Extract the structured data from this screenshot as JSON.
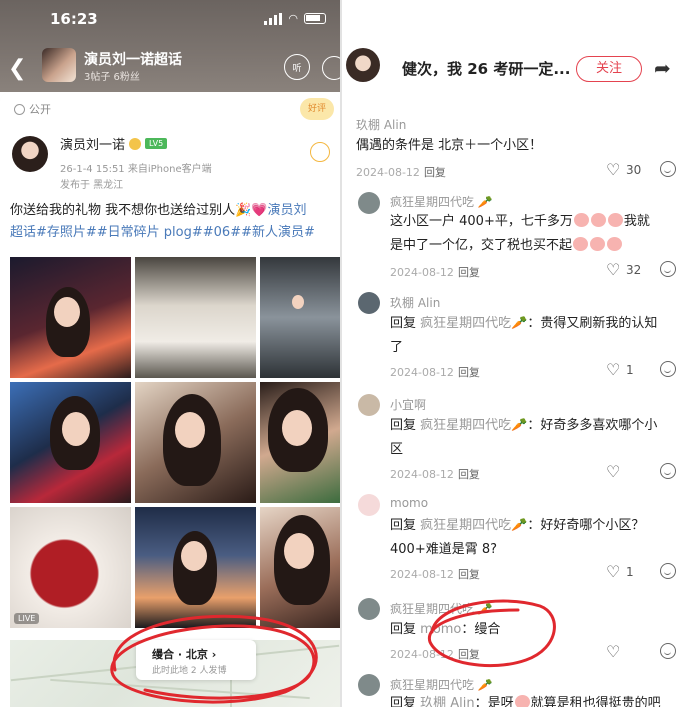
{
  "left": {
    "status_time": "16:23",
    "topic": {
      "title": "演员刘一诺超话",
      "meta": "3帖子 6粉丝",
      "headphone_label": "听"
    },
    "visibility": "公开",
    "fly_badge": "好评",
    "post": {
      "author": "演员刘一诺",
      "level_badge": "LV5",
      "time": "26-1-4 15:51 来自iPhone客户端",
      "location": "发布于 黑龙江",
      "text_main": "你送给我的礼物 我不想你也送给过别人",
      "text_tags_inline": "演员刘",
      "text_tags": "超话#存照片##日常碎片 plog##06##新人演员#"
    },
    "photo_live_label": "LIVE",
    "location_card": {
      "title": "缦合 · 北京",
      "chevron": "›",
      "subtitle": "此时此地 2 人发博"
    }
  },
  "right": {
    "header": {
      "title": "健次，我 26 考研一定...",
      "follow_label": "关注"
    },
    "comments": [
      {
        "name": "玖棚 Alin",
        "body": "偶遇的条件是 北京＋一个小区！",
        "date": "2024-08-12",
        "reply": "回复",
        "likes": "30"
      },
      {
        "name": "疯狂星期四代吃",
        "body_a": "这小区一户 400+平，七千多万",
        "body_b": "我就是中了一个亿，交了税也买不起",
        "date": "2024-08-12",
        "reply": "回复",
        "likes": "32"
      },
      {
        "name": "玖棚 Alin",
        "prefix": "回复",
        "ref": "疯狂星期四代吃",
        "body": "：贵得又刷新我的认知了",
        "date": "2024-08-12",
        "reply": "回复",
        "likes": "1"
      },
      {
        "name": "小宜啊",
        "prefix": "回复",
        "ref": "疯狂星期四代吃",
        "body": "：好奇多多喜欢哪个小区",
        "date": "2024-08-12",
        "reply": "回复",
        "likes": ""
      },
      {
        "name": "momo",
        "prefix": "回复",
        "ref": "疯狂星期四代吃",
        "body": "：好好奇哪个小区？400+难道是霄 8?",
        "date": "2024-08-12",
        "reply": "回复",
        "likes": "1"
      },
      {
        "name": "疯狂星期四代吃",
        "prefix": "回复",
        "ref": "momo",
        "body": "：缦合",
        "date": "2024-08-12",
        "reply": "回复",
        "likes": ""
      },
      {
        "name": "疯狂星期四代吃",
        "prefix": "回复",
        "ref": "玖棚 Alin",
        "body": "：是呀",
        "tail": "就算是租也得挺贵的吧",
        "date": "",
        "reply": "",
        "likes": ""
      }
    ]
  },
  "colors": {
    "accent_red": "#e4434f",
    "link_blue": "#4a7ab9",
    "scribble_red": "#e0282e"
  }
}
